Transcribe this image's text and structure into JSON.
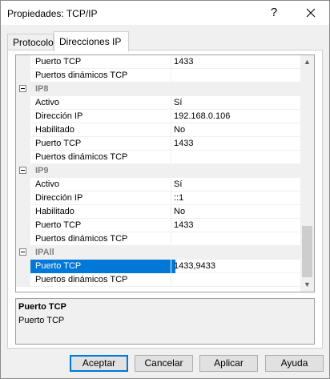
{
  "window": {
    "title": "Propiedades: TCP/IP",
    "help_glyph": "?"
  },
  "tabs": [
    {
      "label": "Protocolo",
      "active": false
    },
    {
      "label": "Direcciones IP",
      "active": true
    }
  ],
  "grid": {
    "rows": [
      {
        "kind": "prop",
        "name": "Puerto TCP",
        "value": "1433"
      },
      {
        "kind": "prop",
        "name": "Puertos dinámicos TCP",
        "value": ""
      },
      {
        "kind": "cat",
        "name": "IP8"
      },
      {
        "kind": "prop",
        "name": "Activo",
        "value": "Sí"
      },
      {
        "kind": "prop",
        "name": "Dirección IP",
        "value": "192.168.0.106"
      },
      {
        "kind": "prop",
        "name": "Habilitado",
        "value": "No"
      },
      {
        "kind": "prop",
        "name": "Puerto TCP",
        "value": "1433"
      },
      {
        "kind": "prop",
        "name": "Puertos dinámicos TCP",
        "value": ""
      },
      {
        "kind": "cat",
        "name": "IP9"
      },
      {
        "kind": "prop",
        "name": "Activo",
        "value": "Sí"
      },
      {
        "kind": "prop",
        "name": "Dirección IP",
        "value": "::1"
      },
      {
        "kind": "prop",
        "name": "Habilitado",
        "value": "No"
      },
      {
        "kind": "prop",
        "name": "Puerto TCP",
        "value": "1433"
      },
      {
        "kind": "prop",
        "name": "Puertos dinámicos TCP",
        "value": ""
      },
      {
        "kind": "cat",
        "name": "IPAll"
      },
      {
        "kind": "prop",
        "name": "Puerto TCP",
        "value": "1433,9433",
        "selected": true
      },
      {
        "kind": "prop",
        "name": "Puertos dinámicos TCP",
        "value": ""
      }
    ]
  },
  "description": {
    "title": "Puerto TCP",
    "text": "Puerto TCP"
  },
  "buttons": {
    "ok": "Aceptar",
    "cancel": "Cancelar",
    "apply": "Aplicar",
    "help": "Ayuda"
  },
  "colors": {
    "selection": "#0078d7",
    "category_bg": "#f0f0f0"
  }
}
